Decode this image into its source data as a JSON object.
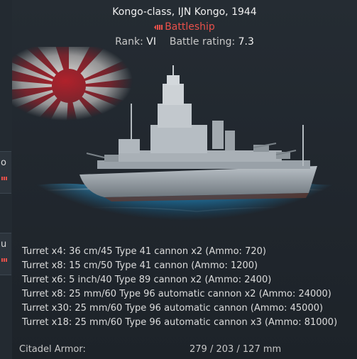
{
  "sidebar": {
    "cards": [
      {
        "char": "o"
      },
      {
        "char": "u"
      }
    ]
  },
  "header": {
    "title": "Kongo-class, IJN Kongo, 1944",
    "class_label": "Battleship",
    "rank_label": "Rank:",
    "rank_value": "VI",
    "br_label": "Battle rating:",
    "br_value": "7.3"
  },
  "illustration": {
    "icon": "rising-sun-flag-icon",
    "subject": "battleship-image"
  },
  "weapons": [
    "Turret x4: 36 cm/45 Type 41 cannon x2 (Ammo: 720)",
    "Turret x8: 15 cm/50 Type 41 cannon (Ammo: 1200)",
    "Turret x6: 5 inch/40 Type 89 cannon x2 (Ammo: 2400)",
    "Turret x8: 25 mm/60 Type 96 automatic cannon x2 (Ammo: 24000)",
    "Turret x30: 25 mm/60 Type 96 automatic cannon (Ammo: 45000)",
    "Turret x18: 25 mm/60 Type 96 automatic cannon x3 (Ammo: 81000)"
  ],
  "armor": {
    "label": "Citadel Armor:",
    "value": "279 / 203 / 127 mm"
  },
  "colors": {
    "accent_red": "#e8504a",
    "panel": "#20262d"
  }
}
